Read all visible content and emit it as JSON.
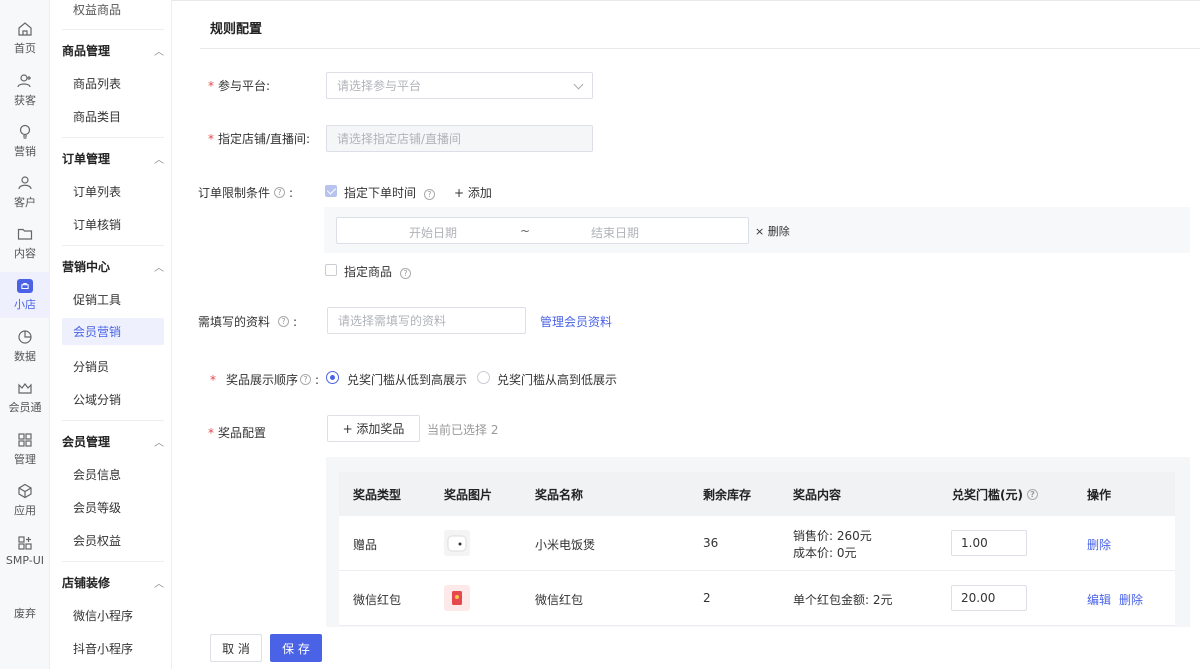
{
  "rail": {
    "items": [
      {
        "label": "首页"
      },
      {
        "label": "获客"
      },
      {
        "label": "营销"
      },
      {
        "label": "客户"
      },
      {
        "label": "内容"
      },
      {
        "label": "小店"
      },
      {
        "label": "数据"
      },
      {
        "label": "会员通"
      },
      {
        "label": "管理"
      },
      {
        "label": "应用"
      },
      {
        "label": "SMP-UI"
      },
      {
        "label": "废弃"
      }
    ]
  },
  "submenu": {
    "top_item": "权益商品",
    "groups": [
      {
        "title": "商品管理",
        "items": [
          "商品列表",
          "商品类目"
        ]
      },
      {
        "title": "订单管理",
        "items": [
          "订单列表",
          "订单核销"
        ]
      },
      {
        "title": "营销中心",
        "items": [
          "促销工具",
          "会员营销",
          "分销员",
          "公域分销"
        ]
      },
      {
        "title": "会员管理",
        "items": [
          "会员信息",
          "会员等级",
          "会员权益"
        ]
      },
      {
        "title": "店铺装修",
        "items": [
          "微信小程序",
          "抖音小程序"
        ]
      }
    ],
    "active_item": "会员营销"
  },
  "form": {
    "section_title": "规则配置",
    "platform": {
      "label": "参与平台:",
      "placeholder": "请选择参与平台"
    },
    "store": {
      "label": "指定店铺/直播间:",
      "placeholder": "请选择指定店铺/直播间"
    },
    "order_limit": {
      "label": "订单限制条件",
      "colon": ":",
      "order_time_label": "指定下单时间",
      "add_label": "+ 添加",
      "start_placeholder": "开始日期",
      "separator": "~",
      "end_placeholder": "结束日期",
      "delete_label": "× 删除",
      "goods_label": "指定商品"
    },
    "info": {
      "label": "需填写的资料",
      "colon": ":",
      "placeholder": "请选择需填写的资料",
      "manage_link": "管理会员资料"
    },
    "order": {
      "label": "奖品展示顺序",
      "colon": ":",
      "opt_low_high": "兑奖门槛从低到高展示",
      "opt_high_low": "兑奖门槛从高到低展示"
    },
    "prize": {
      "label": "奖品配置",
      "add_button": "+   添加奖品",
      "selected_text": "当前已选择 2"
    }
  },
  "table": {
    "headers": [
      "奖品类型",
      "奖品图片",
      "奖品名称",
      "剩余库存",
      "奖品内容",
      "兑奖门槛(元)",
      "操作"
    ],
    "rows": [
      {
        "type": "赠品",
        "name": "小米电饭煲",
        "stock": "36",
        "content_line1": "销售价:  260元",
        "content_line2": "成本价:  0元",
        "threshold": "1.00",
        "actions": [
          "删除"
        ]
      },
      {
        "type": "微信红包",
        "name": "微信红包",
        "stock": "2",
        "content_line1": "单个红包金额:  2元",
        "threshold": "20.00",
        "actions": [
          "编辑",
          "删除"
        ]
      }
    ]
  },
  "footer": {
    "cancel": "取 消",
    "save": "保 存"
  },
  "colors": {
    "accent": "#4a63e6",
    "required": "#e5484d"
  }
}
